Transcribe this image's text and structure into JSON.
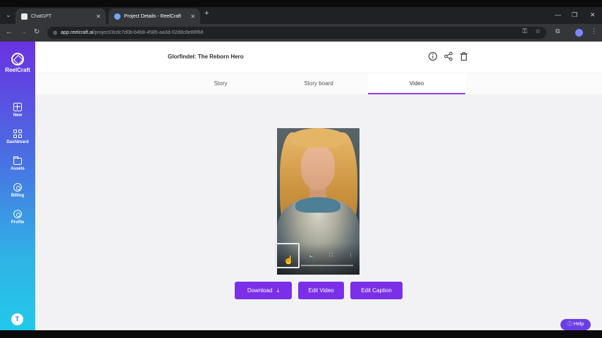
{
  "browser": {
    "tabs": [
      {
        "title": "ChatGPT",
        "active": false
      },
      {
        "title": "Project Details - ReelCraft",
        "active": true
      }
    ],
    "url_host": "app.reelcraft.ai",
    "url_path": "/project/3cdc7d0b-b4b8-4585-aa3d-02d8c8e86f68"
  },
  "sidebar": {
    "brand": "ReelCraft",
    "items": [
      {
        "label": "New",
        "icon": "plus-square-icon"
      },
      {
        "label": "Dashboard",
        "icon": "grid-icon"
      },
      {
        "label": "Assets",
        "icon": "folder-icon"
      },
      {
        "label": "Billing",
        "icon": "billing-icon"
      },
      {
        "label": "Profile",
        "icon": "profile-icon"
      }
    ],
    "user_initial": "T"
  },
  "header": {
    "project_title": "Glorfindel: The Reborn Hero"
  },
  "project_tabs": [
    {
      "label": "Story",
      "active": false
    },
    {
      "label": "Story board",
      "active": false
    },
    {
      "label": "Video",
      "active": true
    }
  ],
  "actions": {
    "download": "Download",
    "edit_video": "Edit Video",
    "edit_caption": "Edit Caption"
  },
  "help_label": "Help",
  "colors": {
    "accent": "#7b2fe8",
    "sidebar_top": "#6a32e0",
    "sidebar_bottom": "#22c8ea"
  }
}
